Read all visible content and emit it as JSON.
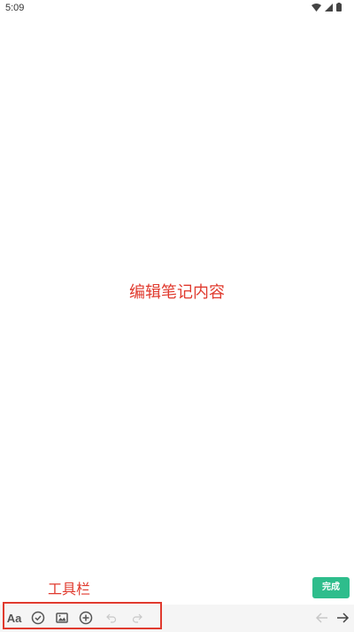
{
  "status_bar": {
    "time": "5:09"
  },
  "editor": {
    "annotation": "编辑笔记内容"
  },
  "toolbar": {
    "annotation": "工具栏",
    "format_label": "Aa",
    "done_label": "完成",
    "icons": {
      "format": "text-format-icon",
      "checklist": "check-circle-icon",
      "image": "image-icon",
      "add": "add-circle-icon",
      "undo": "undo-icon",
      "redo": "redo-icon",
      "back": "arrow-left-icon",
      "forward": "arrow-right-icon"
    }
  },
  "colors": {
    "annotation": "#e03a2e",
    "done_button": "#2ebd8c",
    "toolbar_bg": "#f5f5f5"
  }
}
